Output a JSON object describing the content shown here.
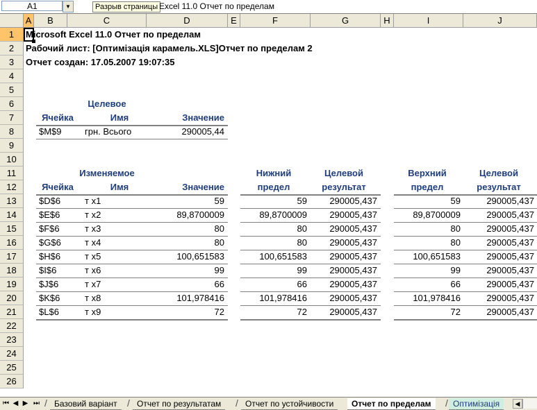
{
  "formula_bar": {
    "name_box": "A1",
    "tooltip": "Разрыв страницы",
    "formula": "Excel 11.0 Отчет по пределам"
  },
  "columns": [
    "A",
    "B",
    "C",
    "D",
    "E",
    "F",
    "G",
    "H",
    "I",
    "J"
  ],
  "rows": [
    "1",
    "2",
    "3",
    "4",
    "5",
    "6",
    "7",
    "8",
    "9",
    "10",
    "11",
    "12",
    "13",
    "14",
    "15",
    "16",
    "17",
    "18",
    "19",
    "20",
    "21",
    "22",
    "23",
    "24",
    "25",
    "26"
  ],
  "report": {
    "title": "Microsoft Excel 11.0 Отчет по пределам",
    "worksheet": "Рабочий лист: [Оптимізація  карамель.XLS]Отчет по пределам 2",
    "created": "Отчет создан: 17.05.2007 19:07:35"
  },
  "target": {
    "header_top": "Целевое",
    "col_cell": "Ячейка",
    "col_name": "Имя",
    "col_value": "Значение",
    "row": {
      "cell": "$M$9",
      "name": "грн. Всього",
      "value": "290005,44"
    }
  },
  "variables": {
    "header_top": "Изменяемое",
    "col_cell": "Ячейка",
    "col_name": "Имя",
    "col_value": "Значение",
    "lower_h1": "Нижний",
    "lower_h2": "предел",
    "lower_res_h1": "Целевой",
    "lower_res_h2": "результат",
    "upper_h1": "Верхний",
    "upper_h2": "предел",
    "upper_res_h1": "Целевой",
    "upper_res_h2": "результат",
    "rows": [
      {
        "cell": "$D$6",
        "name": "т х1",
        "value": "59",
        "lower": "59",
        "lower_res": "290005,437",
        "upper": "59",
        "upper_res": "290005,437"
      },
      {
        "cell": "$E$6",
        "name": "т х2",
        "value": "89,8700009",
        "lower": "89,8700009",
        "lower_res": "290005,437",
        "upper": "89,8700009",
        "upper_res": "290005,437"
      },
      {
        "cell": "$F$6",
        "name": "т х3",
        "value": "80",
        "lower": "80",
        "lower_res": "290005,437",
        "upper": "80",
        "upper_res": "290005,437"
      },
      {
        "cell": "$G$6",
        "name": "т х4",
        "value": "80",
        "lower": "80",
        "lower_res": "290005,437",
        "upper": "80",
        "upper_res": "290005,437"
      },
      {
        "cell": "$H$6",
        "name": "т х5",
        "value": "100,651583",
        "lower": "100,651583",
        "lower_res": "290005,437",
        "upper": "100,651583",
        "upper_res": "290005,437"
      },
      {
        "cell": "$I$6",
        "name": "т х6",
        "value": "99",
        "lower": "99",
        "lower_res": "290005,437",
        "upper": "99",
        "upper_res": "290005,437"
      },
      {
        "cell": "$J$6",
        "name": "т х7",
        "value": "66",
        "lower": "66",
        "lower_res": "290005,437",
        "upper": "66",
        "upper_res": "290005,437"
      },
      {
        "cell": "$K$6",
        "name": "т х8",
        "value": "101,978416",
        "lower": "101,978416",
        "lower_res": "290005,437",
        "upper": "101,978416",
        "upper_res": "290005,437"
      },
      {
        "cell": "$L$6",
        "name": "т х9",
        "value": "72",
        "lower": "72",
        "lower_res": "290005,437",
        "upper": "72",
        "upper_res": "290005,437"
      }
    ]
  },
  "sheet_tabs": {
    "nav": [
      "⏮",
      "◀",
      "▶",
      "⏭"
    ],
    "items": [
      {
        "label": "Базовий варіант",
        "state": "normal"
      },
      {
        "label": "Отчет по результатам",
        "state": "normal"
      },
      {
        "label": "Отчет по устойчивости",
        "state": "normal"
      },
      {
        "label": "Отчет по пределам",
        "state": "active"
      },
      {
        "label": "Оптимізація",
        "state": "green"
      }
    ]
  }
}
